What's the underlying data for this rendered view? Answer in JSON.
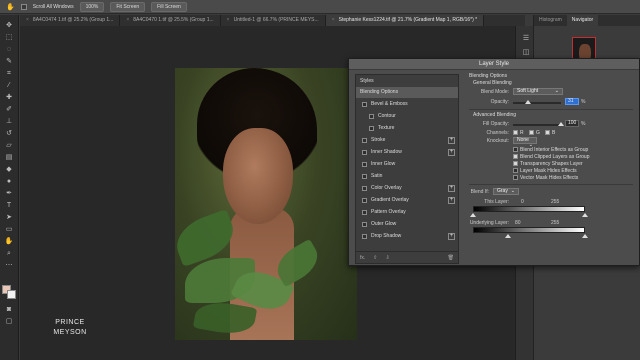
{
  "options_bar": {
    "scroll_all_label": "Scroll All Windows",
    "zoom_value": "100%",
    "fit_screen_label": "Fit Screen",
    "fill_screen_label": "Fill Screen"
  },
  "tabs": [
    {
      "label": "8A4C0474 1.tif @ 25.2% (Group 1..."
    },
    {
      "label": "8A4C0470 1.tif @ 25.5% (Group 1..."
    },
    {
      "label": "Untitled-1 @ 66.7% (PRINCE MEYS..."
    },
    {
      "label": "Stephanie Kess1224.tif @ 21.7% (Gradient Map 1, RGB/16*) *"
    }
  ],
  "right_panel": {
    "tabs": [
      {
        "label": "Histogram"
      },
      {
        "label": "Navigator"
      }
    ]
  },
  "brand": {
    "line1": "PRINCE",
    "line2": "MEYSON"
  },
  "dialog": {
    "title": "Layer Style",
    "styles_header": "Styles",
    "styles": [
      {
        "label": "Blending Options"
      },
      {
        "label": "Bevel & Emboss"
      },
      {
        "label": "Contour"
      },
      {
        "label": "Texture"
      },
      {
        "label": "Stroke"
      },
      {
        "label": "Inner Shadow"
      },
      {
        "label": "Inner Glow"
      },
      {
        "label": "Satin"
      },
      {
        "label": "Color Overlay"
      },
      {
        "label": "Gradient Overlay"
      },
      {
        "label": "Pattern Overlay"
      },
      {
        "label": "Outer Glow"
      },
      {
        "label": "Drop Shadow"
      }
    ],
    "footer_fx": "fx.",
    "blending": {
      "section": "Blending Options",
      "general": "General Blending",
      "blend_mode_label": "Blend Mode:",
      "blend_mode_value": "Soft Light",
      "opacity_label": "Opacity:",
      "opacity_value": "31",
      "opacity_fraction": 0.31,
      "advanced": "Advanced Blending",
      "fill_opacity_label": "Fill Opacity:",
      "fill_opacity_value": "100",
      "fill_opacity_fraction": 1.0,
      "channels_label": "Channels:",
      "channel_r": "R",
      "channel_g": "G",
      "channel_b": "B",
      "knockout_label": "Knockout:",
      "knockout_value": "None",
      "percent": "%",
      "checks": [
        {
          "label": "Blend Interior Effects as Group",
          "on": false
        },
        {
          "label": "Blend Clipped Layers as Group",
          "on": true
        },
        {
          "label": "Transparency Shapes Layer",
          "on": true
        },
        {
          "label": "Layer Mask Hides Effects",
          "on": false
        },
        {
          "label": "Vector Mask Hides Effects",
          "on": false
        }
      ],
      "blend_if_label": "Blend If:",
      "blend_if_value": "Gray",
      "this_layer_label": "This Layer:",
      "this_layer_min": "0",
      "this_layer_max": "255",
      "underlying_label": "Underlying Layer:",
      "underlying_min": "80",
      "underlying_max": "255"
    }
  }
}
